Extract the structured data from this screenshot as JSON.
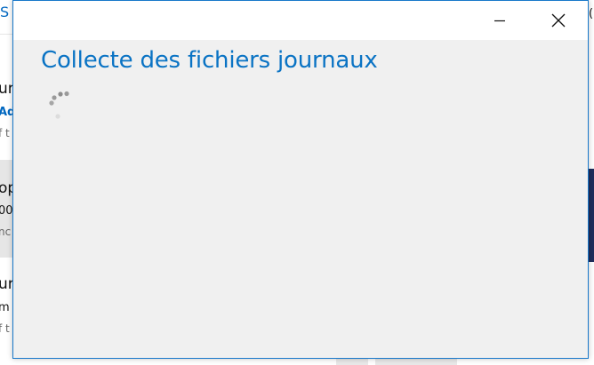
{
  "background_app": {
    "logo_fragment": "S",
    "right_fragment": "(",
    "items": [
      {
        "line1": "ur",
        "line2": "Ad",
        "line2_style": "link",
        "line3": "f t"
      },
      {
        "line1": "op",
        "line2": "00",
        "line2_style": "plain",
        "line3": "nc"
      },
      {
        "line1": "ur",
        "line2": "m",
        "line2_style": "plain",
        "line3": "f t"
      }
    ]
  },
  "dialog": {
    "title": "Collecte des fichiers journaux",
    "minimize_icon": "minimize-icon",
    "close_icon": "close-icon",
    "status": "loading",
    "spinner_icon": "loading-spinner-icon"
  },
  "colors": {
    "accent": "#0a73c4",
    "window_border": "#1979ca",
    "dialog_background": "#f0f0f0",
    "titlebar_background": "#ffffff"
  }
}
